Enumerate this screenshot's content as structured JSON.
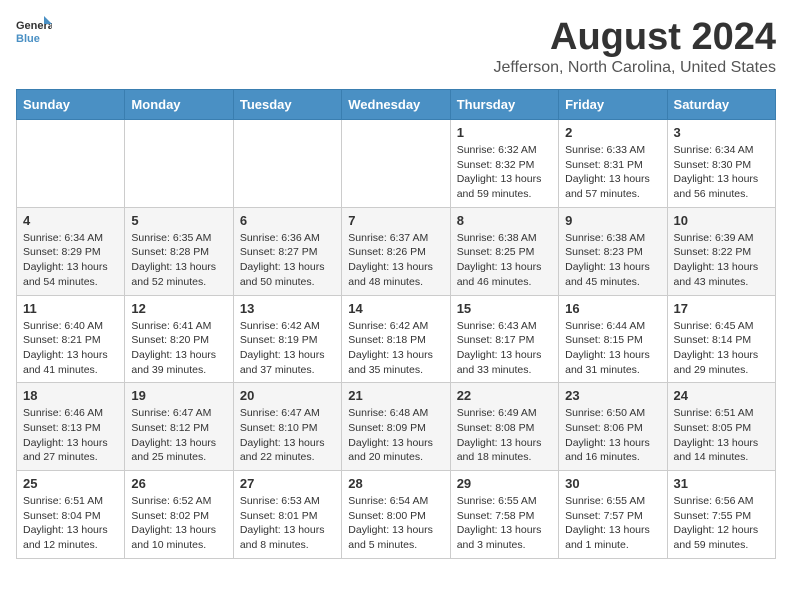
{
  "logo": {
    "line1": "General",
    "line2": "Blue"
  },
  "title": "August 2024",
  "subtitle": "Jefferson, North Carolina, United States",
  "days_of_week": [
    "Sunday",
    "Monday",
    "Tuesday",
    "Wednesday",
    "Thursday",
    "Friday",
    "Saturday"
  ],
  "weeks": [
    [
      {
        "day": "",
        "info": ""
      },
      {
        "day": "",
        "info": ""
      },
      {
        "day": "",
        "info": ""
      },
      {
        "day": "",
        "info": ""
      },
      {
        "day": "1",
        "info": "Sunrise: 6:32 AM\nSunset: 8:32 PM\nDaylight: 13 hours\nand 59 minutes."
      },
      {
        "day": "2",
        "info": "Sunrise: 6:33 AM\nSunset: 8:31 PM\nDaylight: 13 hours\nand 57 minutes."
      },
      {
        "day": "3",
        "info": "Sunrise: 6:34 AM\nSunset: 8:30 PM\nDaylight: 13 hours\nand 56 minutes."
      }
    ],
    [
      {
        "day": "4",
        "info": "Sunrise: 6:34 AM\nSunset: 8:29 PM\nDaylight: 13 hours\nand 54 minutes."
      },
      {
        "day": "5",
        "info": "Sunrise: 6:35 AM\nSunset: 8:28 PM\nDaylight: 13 hours\nand 52 minutes."
      },
      {
        "day": "6",
        "info": "Sunrise: 6:36 AM\nSunset: 8:27 PM\nDaylight: 13 hours\nand 50 minutes."
      },
      {
        "day": "7",
        "info": "Sunrise: 6:37 AM\nSunset: 8:26 PM\nDaylight: 13 hours\nand 48 minutes."
      },
      {
        "day": "8",
        "info": "Sunrise: 6:38 AM\nSunset: 8:25 PM\nDaylight: 13 hours\nand 46 minutes."
      },
      {
        "day": "9",
        "info": "Sunrise: 6:38 AM\nSunset: 8:23 PM\nDaylight: 13 hours\nand 45 minutes."
      },
      {
        "day": "10",
        "info": "Sunrise: 6:39 AM\nSunset: 8:22 PM\nDaylight: 13 hours\nand 43 minutes."
      }
    ],
    [
      {
        "day": "11",
        "info": "Sunrise: 6:40 AM\nSunset: 8:21 PM\nDaylight: 13 hours\nand 41 minutes."
      },
      {
        "day": "12",
        "info": "Sunrise: 6:41 AM\nSunset: 8:20 PM\nDaylight: 13 hours\nand 39 minutes."
      },
      {
        "day": "13",
        "info": "Sunrise: 6:42 AM\nSunset: 8:19 PM\nDaylight: 13 hours\nand 37 minutes."
      },
      {
        "day": "14",
        "info": "Sunrise: 6:42 AM\nSunset: 8:18 PM\nDaylight: 13 hours\nand 35 minutes."
      },
      {
        "day": "15",
        "info": "Sunrise: 6:43 AM\nSunset: 8:17 PM\nDaylight: 13 hours\nand 33 minutes."
      },
      {
        "day": "16",
        "info": "Sunrise: 6:44 AM\nSunset: 8:15 PM\nDaylight: 13 hours\nand 31 minutes."
      },
      {
        "day": "17",
        "info": "Sunrise: 6:45 AM\nSunset: 8:14 PM\nDaylight: 13 hours\nand 29 minutes."
      }
    ],
    [
      {
        "day": "18",
        "info": "Sunrise: 6:46 AM\nSunset: 8:13 PM\nDaylight: 13 hours\nand 27 minutes."
      },
      {
        "day": "19",
        "info": "Sunrise: 6:47 AM\nSunset: 8:12 PM\nDaylight: 13 hours\nand 25 minutes."
      },
      {
        "day": "20",
        "info": "Sunrise: 6:47 AM\nSunset: 8:10 PM\nDaylight: 13 hours\nand 22 minutes."
      },
      {
        "day": "21",
        "info": "Sunrise: 6:48 AM\nSunset: 8:09 PM\nDaylight: 13 hours\nand 20 minutes."
      },
      {
        "day": "22",
        "info": "Sunrise: 6:49 AM\nSunset: 8:08 PM\nDaylight: 13 hours\nand 18 minutes."
      },
      {
        "day": "23",
        "info": "Sunrise: 6:50 AM\nSunset: 8:06 PM\nDaylight: 13 hours\nand 16 minutes."
      },
      {
        "day": "24",
        "info": "Sunrise: 6:51 AM\nSunset: 8:05 PM\nDaylight: 13 hours\nand 14 minutes."
      }
    ],
    [
      {
        "day": "25",
        "info": "Sunrise: 6:51 AM\nSunset: 8:04 PM\nDaylight: 13 hours\nand 12 minutes."
      },
      {
        "day": "26",
        "info": "Sunrise: 6:52 AM\nSunset: 8:02 PM\nDaylight: 13 hours\nand 10 minutes."
      },
      {
        "day": "27",
        "info": "Sunrise: 6:53 AM\nSunset: 8:01 PM\nDaylight: 13 hours\nand 8 minutes."
      },
      {
        "day": "28",
        "info": "Sunrise: 6:54 AM\nSunset: 8:00 PM\nDaylight: 13 hours\nand 5 minutes."
      },
      {
        "day": "29",
        "info": "Sunrise: 6:55 AM\nSunset: 7:58 PM\nDaylight: 13 hours\nand 3 minutes."
      },
      {
        "day": "30",
        "info": "Sunrise: 6:55 AM\nSunset: 7:57 PM\nDaylight: 13 hours\nand 1 minute."
      },
      {
        "day": "31",
        "info": "Sunrise: 6:56 AM\nSunset: 7:55 PM\nDaylight: 12 hours\nand 59 minutes."
      }
    ]
  ]
}
